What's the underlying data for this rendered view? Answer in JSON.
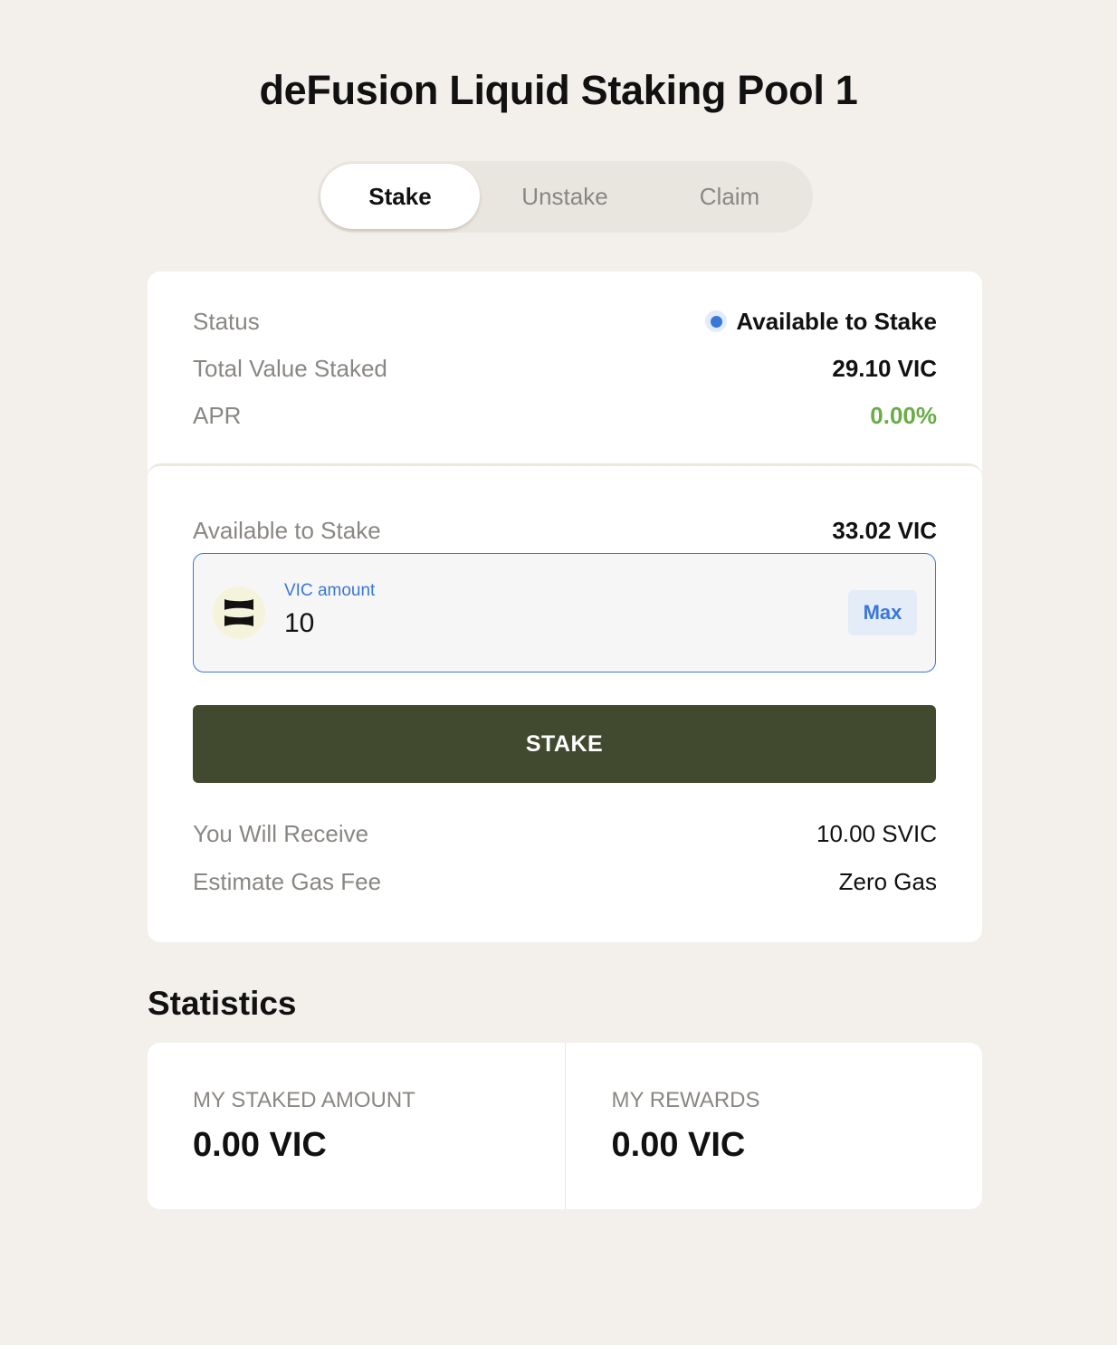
{
  "page": {
    "title": "deFusion Liquid Staking Pool 1"
  },
  "tabs": [
    {
      "label": "Stake",
      "active": true
    },
    {
      "label": "Unstake",
      "active": false
    },
    {
      "label": "Claim",
      "active": false
    }
  ],
  "pool_info": {
    "status_label": "Status",
    "status_value": "Available to Stake",
    "status_color": "#3a78d8",
    "tvs_label": "Total Value Staked",
    "tvs_value": "29.10 VIC",
    "apr_label": "APR",
    "apr_value": "0.00%",
    "apr_color": "#6aac45"
  },
  "stake_form": {
    "available_label": "Available to Stake",
    "available_value": "33.02 VIC",
    "token_icon": "vic-token-icon",
    "amount_label": "VIC amount",
    "amount_value": "10",
    "max_label": "Max",
    "submit_label": "STAKE",
    "submit_color": "#414a2f",
    "receive_label": "You Will Receive",
    "receive_value": "10.00 SVIC",
    "gas_label": "Estimate Gas Fee",
    "gas_value": "Zero Gas"
  },
  "statistics": {
    "heading": "Statistics",
    "items": [
      {
        "label": "MY STAKED AMOUNT",
        "value": "0.00 VIC"
      },
      {
        "label": "MY REWARDS",
        "value": "0.00 VIC"
      }
    ]
  }
}
